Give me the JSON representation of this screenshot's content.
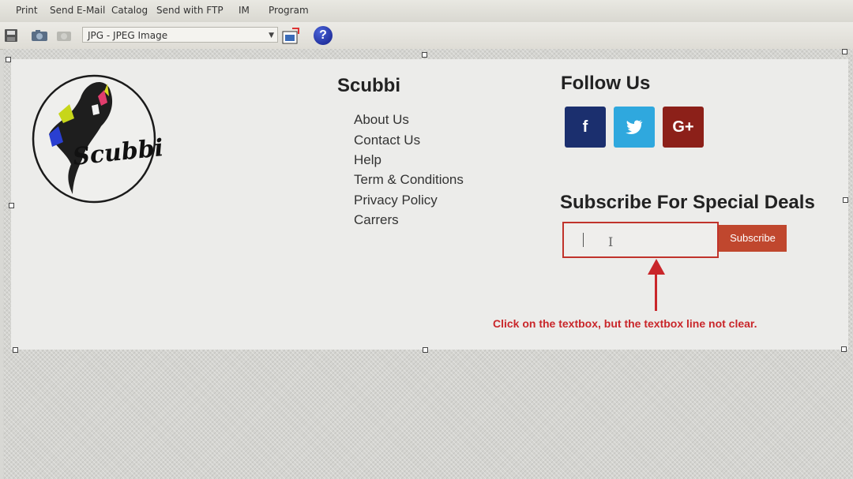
{
  "app": {
    "menu": [
      "Print",
      "Send E-Mail",
      "Catalog",
      "Send with FTP",
      "IM",
      "Program"
    ],
    "format_select": "JPG - JPEG Image",
    "help_label": "?"
  },
  "footer": {
    "logo_text": "Scubbi",
    "brand_title": "Scubbi",
    "links": [
      "About Us",
      "Contact Us",
      "Help",
      "Term & Conditions",
      "Privacy Policy",
      "Carrers"
    ],
    "follow_title": "Follow Us",
    "social": [
      {
        "label": "f",
        "color": "#1b2f6e"
      },
      {
        "label": "✉",
        "color": "#2fa8de"
      },
      {
        "label": "G+",
        "color": "#8c2019"
      }
    ],
    "subscribe_title": "Subscribe For Special Deals",
    "subscribe_input_value": "",
    "subscribe_button": "Subscribe"
  },
  "annotation": {
    "text": "Click on the textbox, but the textbox line not clear.",
    "color": "#c9262a"
  }
}
